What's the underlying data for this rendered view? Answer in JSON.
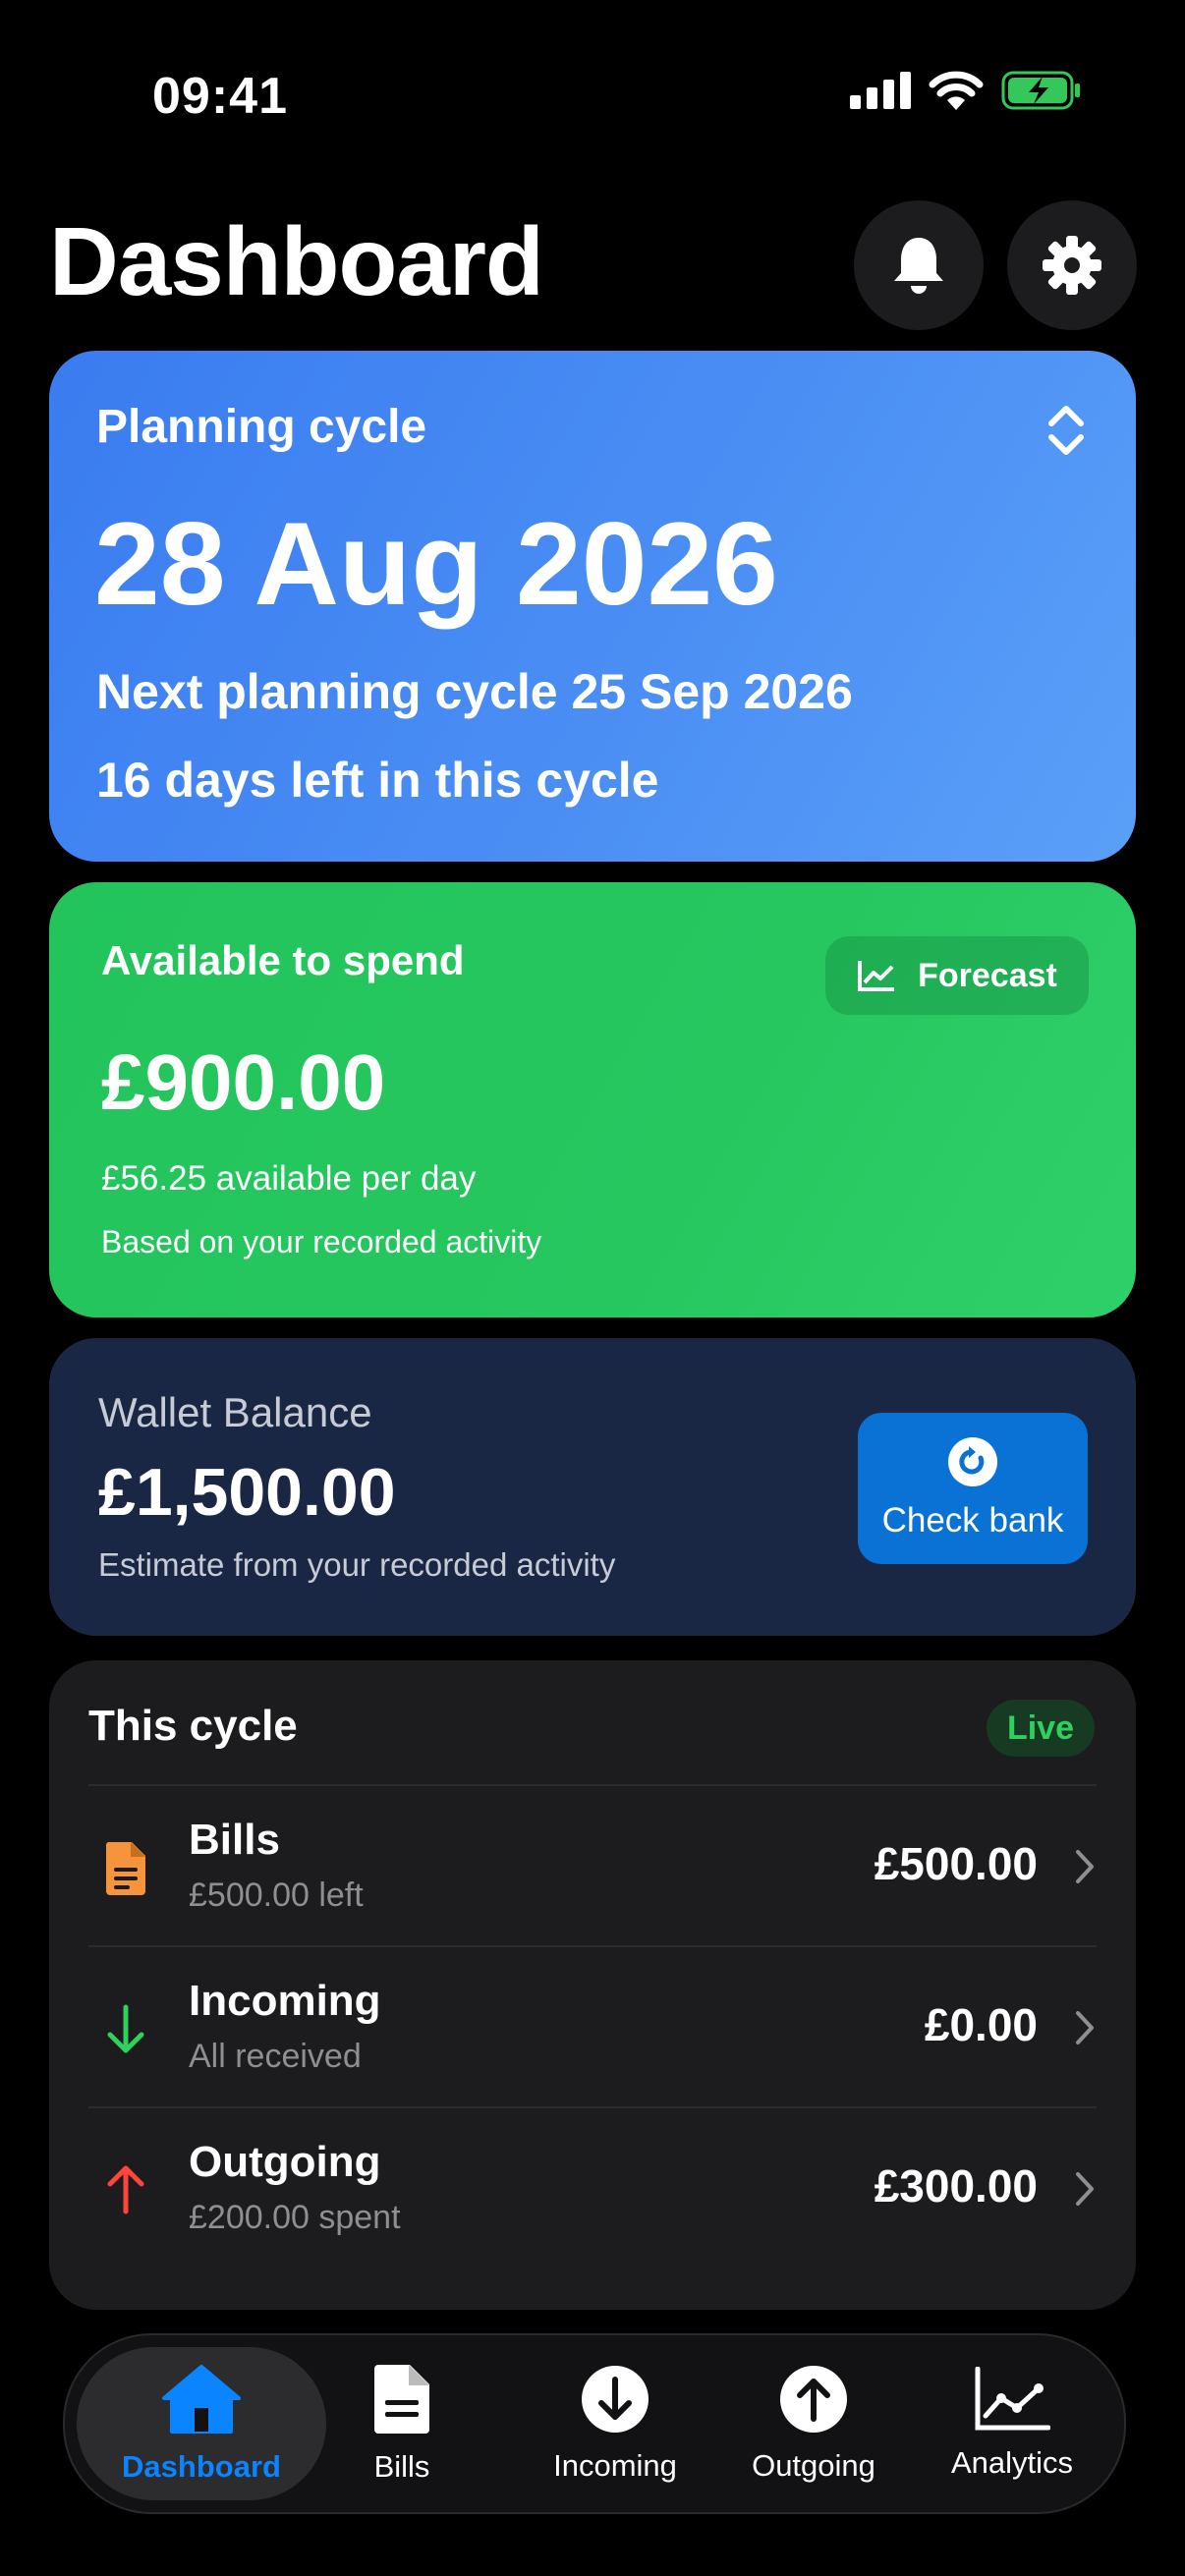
{
  "status_bar": {
    "time": "09:41"
  },
  "header": {
    "title": "Dashboard"
  },
  "planning": {
    "label": "Planning cycle",
    "date": "28 Aug 2026",
    "next": "Next planning cycle 25 Sep 2026",
    "days_left": "16 days left in this cycle"
  },
  "spend": {
    "label": "Available to spend",
    "forecast_label": "Forecast",
    "amount": "£900.00",
    "per_day": "£56.25 available per day",
    "note": "Based on your recorded activity"
  },
  "wallet": {
    "label": "Wallet Balance",
    "amount": "£1,500.00",
    "note": "Estimate from your recorded activity",
    "check_label": "Check bank"
  },
  "cycle": {
    "title": "This cycle",
    "badge": "Live",
    "rows": [
      {
        "label": "Bills",
        "sub": "£500.00 left",
        "amount": "£500.00",
        "icon": "document-icon",
        "color": "#f5943a"
      },
      {
        "label": "Incoming",
        "sub": "All received",
        "amount": "£0.00",
        "icon": "arrow-down-icon",
        "color": "#2fd15e"
      },
      {
        "label": "Outgoing",
        "sub": "£200.00 spent",
        "amount": "£300.00",
        "icon": "arrow-up-icon",
        "color": "#ff453a"
      }
    ]
  },
  "tabs": [
    {
      "label": "Dashboard",
      "icon": "house-icon",
      "active": true
    },
    {
      "label": "Bills",
      "icon": "document-icon"
    },
    {
      "label": "Incoming",
      "icon": "arrow-down-circle-icon"
    },
    {
      "label": "Outgoing",
      "icon": "arrow-up-circle-icon"
    },
    {
      "label": "Analytics",
      "icon": "chart-icon"
    }
  ],
  "colors": {
    "accent": "#0a84ff",
    "plan_card": "#3a7cf0",
    "spend_card": "#22c45b",
    "wallet_card": "#1a2744",
    "battery": "#34c759"
  }
}
